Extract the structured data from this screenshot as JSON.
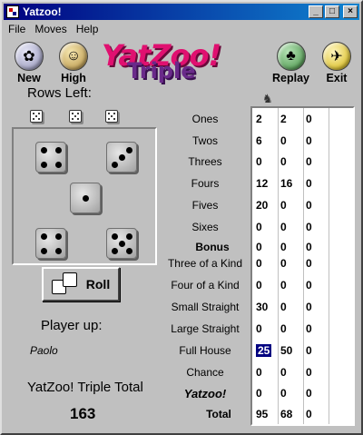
{
  "window": {
    "title": "Yatzoo!"
  },
  "menu": [
    "File",
    "Moves",
    "Help"
  ],
  "toolbar": {
    "new_label": "New",
    "high_label": "High",
    "replay_label": "Replay",
    "exit_label": "Exit"
  },
  "logo": {
    "top": "YatZoo!",
    "bottom": "Triple"
  },
  "rows_left_label": "Rows Left:",
  "dice": [
    4,
    3,
    1,
    4,
    5
  ],
  "roll_label": "Roll",
  "player_up_label": "Player up:",
  "player_name": "Paolo",
  "total_label": "YatZoo! Triple Total",
  "total_value": "163",
  "categories": [
    "Ones",
    "Twos",
    "Threes",
    "Fours",
    "Fives",
    "Sixes",
    "Bonus",
    "Three of a Kind",
    "Four of a Kind",
    "Small Straight",
    "Large Straight",
    "Full House",
    "Chance",
    "Yatzoo!",
    "Total"
  ],
  "scores": [
    [
      "2",
      "2",
      "0"
    ],
    [
      "6",
      "0",
      "0"
    ],
    [
      "0",
      "0",
      "0"
    ],
    [
      "12",
      "16",
      "0"
    ],
    [
      "20",
      "0",
      "0"
    ],
    [
      "0",
      "0",
      "0"
    ],
    [
      "0",
      "0",
      "0"
    ],
    [
      "0",
      "0",
      "0"
    ],
    [
      "0",
      "0",
      "0"
    ],
    [
      "30",
      "0",
      "0"
    ],
    [
      "0",
      "0",
      "0"
    ],
    [
      "25",
      "50",
      "0"
    ],
    [
      "0",
      "0",
      "0"
    ],
    [
      "0",
      "0",
      "0"
    ],
    [
      "95",
      "68",
      "0"
    ]
  ],
  "highlight_cell": {
    "row": 11,
    "col": 0
  },
  "colors": {
    "title_bar": "#000080",
    "logo_pink": "#e01070",
    "logo_purple": "#6a2a8a",
    "highlight": "#000080"
  }
}
